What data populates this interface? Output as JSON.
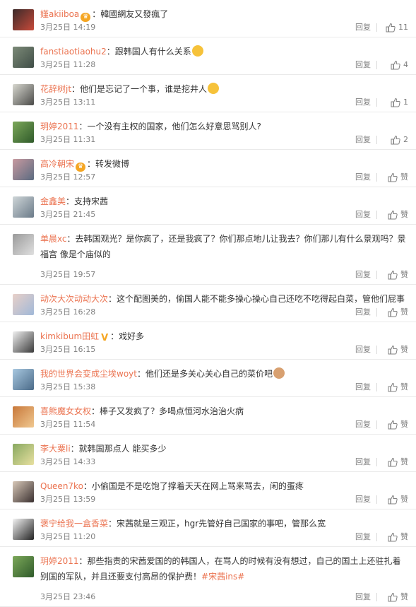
{
  "comments": [
    {
      "user": "嫤akiiboa",
      "badge": "crown",
      "text": "：韓國網友又發瘋了",
      "emoji": "",
      "time": "3月25日 14:19",
      "reply": "回复",
      "likes": "11",
      "avatar": [
        "#3a2a2a",
        "#c84a3a"
      ]
    },
    {
      "user": "fanstiaotiaohu2",
      "badge": "",
      "text": "：跟韩国人有什么关系",
      "emoji": "laugh-cry",
      "time": "3月25日 11:28",
      "reply": "回复",
      "likes": "4",
      "avatar": [
        "#7c8a78",
        "#3f4d46"
      ]
    },
    {
      "user": "花辞树jt",
      "badge": "",
      "text": "：他们是忘记了一个事，谁是挖井人",
      "emoji": "grin",
      "time": "3月25日 13:11",
      "reply": "回复",
      "likes": "1",
      "avatar": [
        "#d8d8d0",
        "#4a4a48"
      ]
    },
    {
      "user": "玥婷2011",
      "badge": "",
      "text": "：一个没有主权的国家，他们怎么好意思骂别人?",
      "emoji": "",
      "time": "3月25日 11:31",
      "reply": "回复",
      "likes": "2",
      "avatar": [
        "#7ca85a",
        "#2f5a2a"
      ]
    },
    {
      "user": "高冷朝宋",
      "badge": "crown",
      "text": "：转发微博",
      "emoji": "",
      "time": "3月25日 12:57",
      "reply": "回复",
      "likes": "赞",
      "avatar": [
        "#c89aa0",
        "#5a6a80"
      ]
    },
    {
      "user": "金鑫美",
      "badge": "",
      "text": "：支持宋茜",
      "emoji": "",
      "time": "3月25日 21:45",
      "reply": "回复",
      "likes": "赞",
      "avatar": [
        "#cfd6d8",
        "#6a7a88"
      ]
    },
    {
      "user": "单晨xc",
      "badge": "",
      "text": "：去韩国观光？是你疯了，还是我疯了？你们那点地儿让我去？你们那儿有什么景观吗？景福宫  像是个庙似的",
      "emoji": "",
      "time": "3月25日 19:57",
      "reply": "回复",
      "likes": "赞",
      "avatar": [
        "#9a9a9a",
        "#e0e0e0"
      ]
    },
    {
      "user": "动次大次动动大次",
      "badge": "",
      "text": "：这个配图美的，偷国人能不能多操心操心自己还吃不吃得起白菜，管他们屁事",
      "emoji": "",
      "time": "3月25日 16:28",
      "reply": "回复",
      "likes": "赞",
      "avatar": [
        "#e8d0c8",
        "#a0b8d8"
      ]
    },
    {
      "user": "kimkibum田虹",
      "badge": "v",
      "text": "：戏好多",
      "emoji": "",
      "time": "3月25日 16:15",
      "reply": "回复",
      "likes": "赞",
      "avatar": [
        "#f0f0f0",
        "#3a3a3a"
      ]
    },
    {
      "user": "我的世界会变成尘埃woyt",
      "badge": "",
      "text": "：他们还是多关心关心自己的菜价吧",
      "emoji": "cat",
      "time": "3月25日 15:38",
      "reply": "回复",
      "likes": "赞",
      "avatar": [
        "#a8c8e0",
        "#4a6a88"
      ]
    },
    {
      "user": "喜熊魔女女权",
      "badge": "",
      "text": "：棒子又发疯了？多喝点恒河水治治火病",
      "emoji": "",
      "time": "3月25日 11:54",
      "reply": "回复",
      "likes": "赞",
      "avatar": [
        "#c8783a",
        "#f0c890"
      ]
    },
    {
      "user": "李大粟li",
      "badge": "",
      "text": "：就韩国那点人  能买多少",
      "emoji": "",
      "time": "3月25日 14:33",
      "reply": "回复",
      "likes": "赞",
      "avatar": [
        "#88a860",
        "#e8e0a0"
      ]
    },
    {
      "user": "Queen7ko",
      "badge": "",
      "text": "：小偷国是不是吃饱了撑着天天在网上骂来骂去，闲的蛋疼",
      "emoji": "",
      "time": "3月25日 13:59",
      "reply": "回复",
      "likes": "赞",
      "avatar": [
        "#d8c8b8",
        "#3a3030"
      ]
    },
    {
      "user": "褒宁给我一盒香菜",
      "badge": "",
      "text": "：宋茜就是三观正，hgr先管好自己国家的事吧，管那么宽",
      "emoji": "",
      "time": "3月25日 11:20",
      "reply": "回复",
      "likes": "赞",
      "avatar": [
        "#f4f4f4",
        "#222222"
      ]
    },
    {
      "user": "玥婷2011",
      "badge": "",
      "text": "：那些指责的宋茜爱国的的韩国人，在骂人的时候有没有想过，自己的国土上还驻扎着别国的军队，并且还要支付高昂的保护费！",
      "topic": "#宋茜ins#",
      "emoji": "",
      "time": "3月25日 23:46",
      "reply": "回复",
      "likes": "赞",
      "avatar": [
        "#7ca85a",
        "#2f5a2a"
      ]
    }
  ],
  "emoji_colors": {
    "laugh-cry": "#f6c23a",
    "grin": "#f6c23a",
    "cat": "#d8a070"
  },
  "colors": {
    "username": "#eb7350",
    "meta": "#808080",
    "text": "#333333"
  }
}
